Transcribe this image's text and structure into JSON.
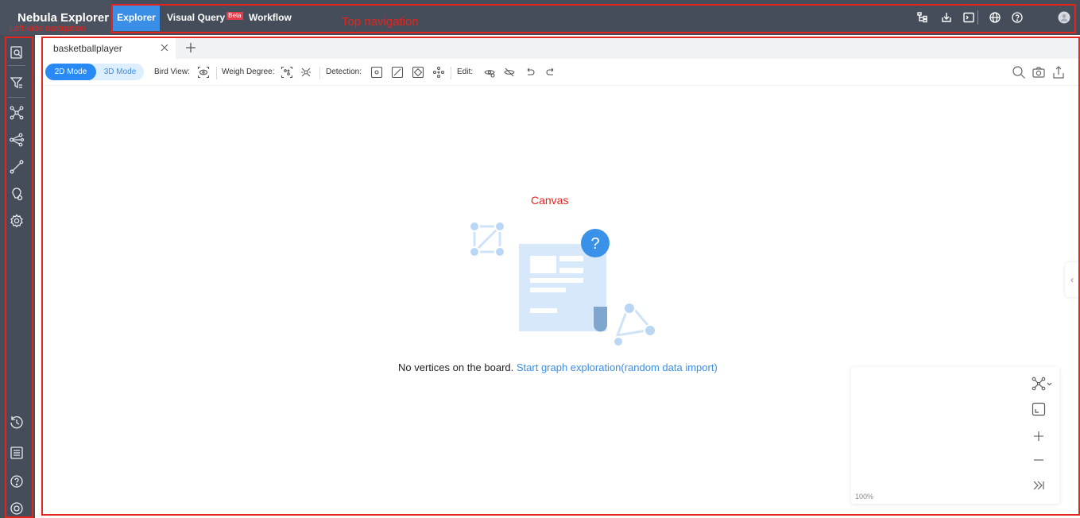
{
  "brand": {
    "title": "Nebula Explorer",
    "annotation": "Left-side navigation"
  },
  "topnav": {
    "items": [
      {
        "label": "Explorer"
      },
      {
        "label": "Visual Query",
        "badge": "Beta"
      },
      {
        "label": "Workflow"
      }
    ],
    "annotation": "Top navigation",
    "right_icons": [
      "schema-icon",
      "import-icon",
      "console-icon",
      "globe-icon",
      "help-icon",
      "user-avatar-icon"
    ]
  },
  "leftnav": {
    "top_icons": [
      "search-vertex-icon",
      "filter-icon",
      "graph-algorithm-icon",
      "share-graph-icon",
      "path-icon",
      "vertex-property-icon",
      "settings-icon"
    ],
    "bottom_icons": [
      "history-icon",
      "template-icon",
      "help-icon",
      "setting-circle-icon"
    ]
  },
  "tabs": [
    {
      "label": "basketballplayer"
    }
  ],
  "toolbar": {
    "mode_2d": "2D Mode",
    "mode_3d": "3D Mode",
    "bird_view_label": "Bird View:",
    "weigh_degree_label": "Weigh Degree:",
    "detection_label": "Detection:",
    "edit_label": "Edit:"
  },
  "canvas": {
    "annotation": "Canvas",
    "empty_text": "No vertices on the board.",
    "empty_link": "Start graph exploration(random data import)"
  },
  "minimap": {
    "zoom": "100%"
  },
  "colors": {
    "topbar": "#454d5a",
    "accent": "#3a8ee6",
    "annotation": "#e3251e"
  }
}
